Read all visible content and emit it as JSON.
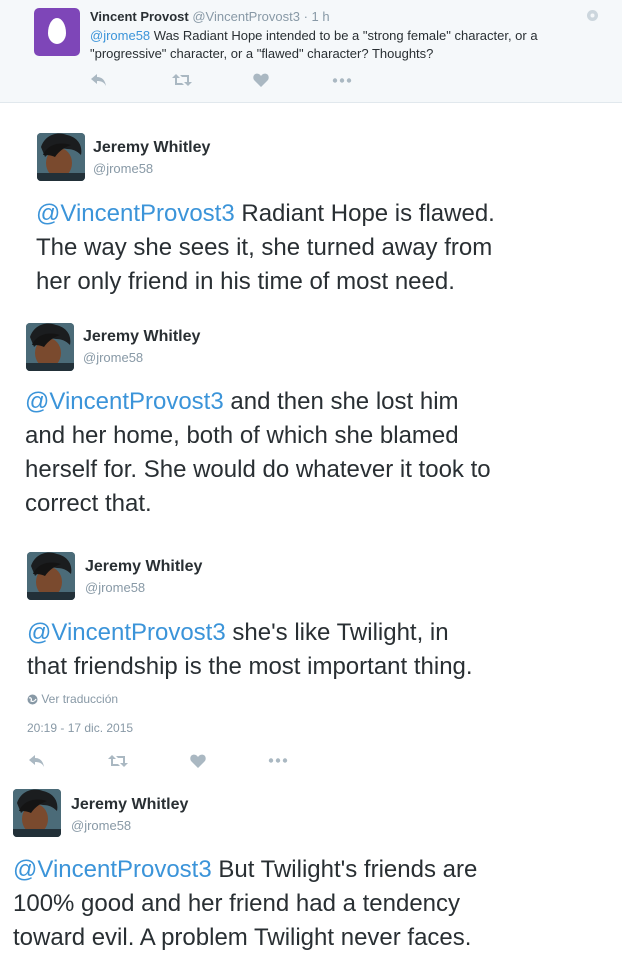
{
  "top_tweet": {
    "name": "Vincent Provost",
    "handle": "@VincentProvost3",
    "time": "· 1 h",
    "mention": "@jrome58",
    "text_line1": " Was Radiant Hope intended to be a \"strong female\" character, or a",
    "text_line2": "\"progressive\" character, or a \"flawed\" character? Thoughts?"
  },
  "tweets": [
    {
      "name": "Jeremy Whitley",
      "handle": "@jrome58",
      "mention": "@VincentProvost3",
      "line1_rest": " Radiant Hope is flawed.",
      "line2": "The way she sees it, she turned away from",
      "line3": "her only friend in his time of most need."
    },
    {
      "name": "Jeremy Whitley",
      "handle": "@jrome58",
      "mention": "@VincentProvost3",
      "line1_rest": " and then she lost him",
      "line2": "and her home, both of which she blamed",
      "line3": "herself for. She would do whatever it took to",
      "line4": "correct that."
    },
    {
      "name": "Jeremy Whitley",
      "handle": "@jrome58",
      "mention": "@VincentProvost3",
      "line1_rest": " she's like Twilight, in",
      "line2": "that friendship is the most important thing.",
      "translate": "Ver traducción",
      "timestamp": "20:19 - 17 dic. 2015"
    },
    {
      "name": "Jeremy Whitley",
      "handle": "@jrome58",
      "mention": "@VincentProvost3",
      "line1_rest": " But Twilight's friends are",
      "line2": "100% good and her friend had a tendency",
      "line3": "toward evil. A problem Twilight never faces."
    }
  ],
  "icons": [
    "reply-icon",
    "retweet-icon",
    "like-icon",
    "more-icon",
    "globe-icon",
    "settings-icon"
  ]
}
